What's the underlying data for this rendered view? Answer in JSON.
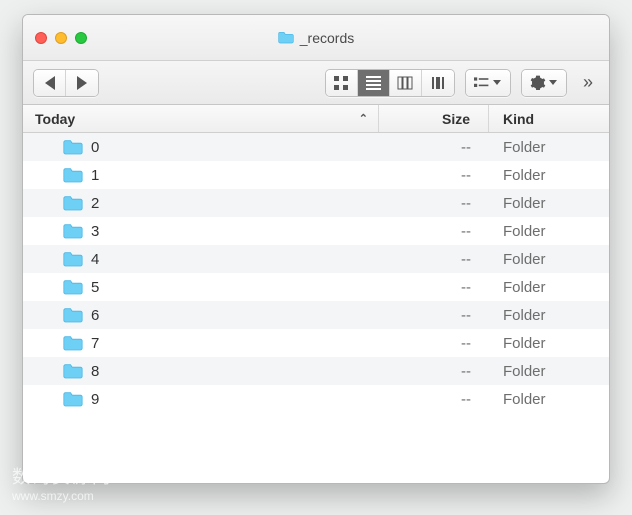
{
  "window": {
    "title": "_records"
  },
  "columns": {
    "name": "Today",
    "size": "Size",
    "kind": "Kind",
    "sort_indicator": "⌃"
  },
  "rows": [
    {
      "name": "0",
      "size": "--",
      "kind": "Folder"
    },
    {
      "name": "1",
      "size": "--",
      "kind": "Folder"
    },
    {
      "name": "2",
      "size": "--",
      "kind": "Folder"
    },
    {
      "name": "3",
      "size": "--",
      "kind": "Folder"
    },
    {
      "name": "4",
      "size": "--",
      "kind": "Folder"
    },
    {
      "name": "5",
      "size": "--",
      "kind": "Folder"
    },
    {
      "name": "6",
      "size": "--",
      "kind": "Folder"
    },
    {
      "name": "7",
      "size": "--",
      "kind": "Folder"
    },
    {
      "name": "8",
      "size": "--",
      "kind": "Folder"
    },
    {
      "name": "9",
      "size": "--",
      "kind": "Folder"
    }
  ],
  "watermark": {
    "line1": "数码资源网",
    "line2": "www.smzy.com"
  }
}
